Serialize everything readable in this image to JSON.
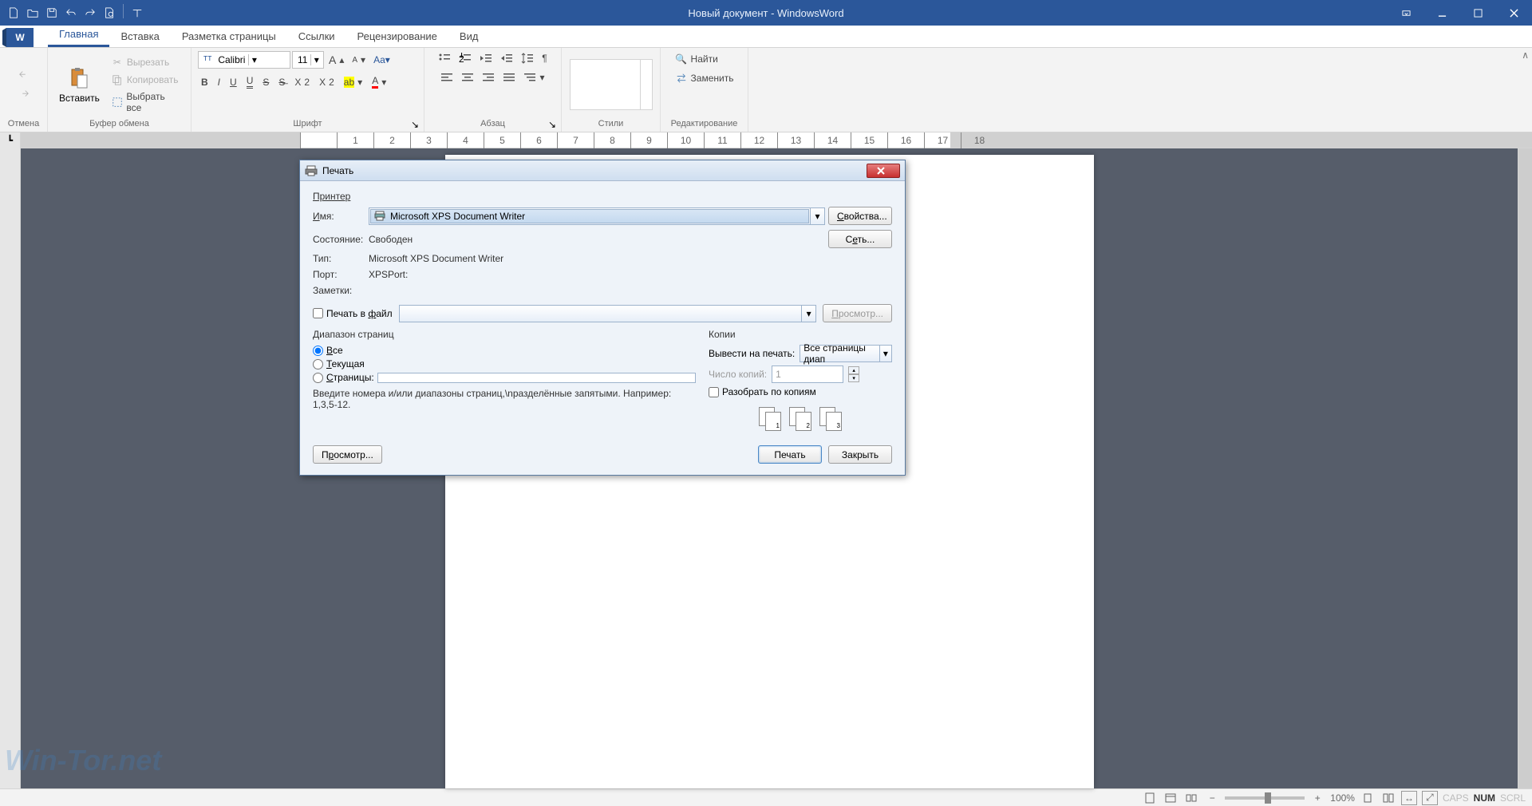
{
  "titlebar": {
    "title": "Новый документ - WindowsWord"
  },
  "tabs": {
    "home": "Главная",
    "insert": "Вставка",
    "page_layout": "Разметка страницы",
    "links": "Ссылки",
    "review": "Рецензирование",
    "view": "Вид"
  },
  "ribbon": {
    "undo_group": "Отмена",
    "clipboard": {
      "paste": "Вставить",
      "cut": "Вырезать",
      "copy": "Копировать",
      "select_all": "Выбрать все",
      "label": "Буфер обмена"
    },
    "font": {
      "name": "Calibri",
      "size": "11",
      "label": "Шрифт"
    },
    "paragraph": {
      "label": "Абзац"
    },
    "styles": {
      "label": "Стили"
    },
    "editing": {
      "find": "Найти",
      "replace": "Заменить",
      "label": "Редактирование"
    }
  },
  "dialog": {
    "title": "Печать",
    "printer_section": "Принтер",
    "name": "Имя:",
    "name_val": "Microsoft XPS Document Writer",
    "status": "Состояние:",
    "status_val": "Свободен",
    "type": "Тип:",
    "type_val": "Microsoft XPS Document Writer",
    "port": "Порт:",
    "port_val": "XPSPort:",
    "notes": "Заметки:",
    "properties": "Свойства...",
    "network": "Сеть...",
    "print_to_file": "Печать в файл",
    "browse": "Просмотр...",
    "range_section": "Диапазон страниц",
    "all": "Все",
    "current": "Текущая",
    "pages": "Страницы:",
    "range_hint": "Введите номера и/или диапазоны страниц,\\nразделённые запятыми. Например: 1,3,5-12.",
    "copies_section": "Копии",
    "output": "Вывести на печать:",
    "output_val": "Все страницы диап",
    "num_copies": "Число копий:",
    "num_copies_val": "1",
    "collate": "Разобрать по копиям",
    "preview": "Просмотр...",
    "print": "Печать",
    "close": "Закрыть"
  },
  "statusbar": {
    "zoom": "100%",
    "caps": "CAPS",
    "num": "NUM",
    "scrl": "SCRL"
  },
  "watermark": "Win-Tor.net"
}
